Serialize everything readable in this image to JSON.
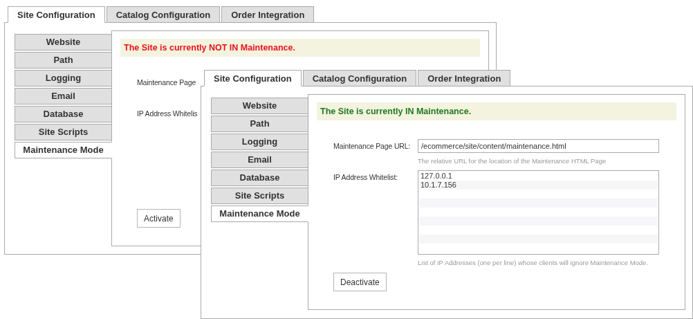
{
  "windows": [
    {
      "tabs": [
        {
          "label": "Site Configuration",
          "selected": true
        },
        {
          "label": "Catalog Configuration",
          "selected": false
        },
        {
          "label": "Order Integration",
          "selected": false
        }
      ],
      "nav": [
        {
          "label": "Website",
          "selected": false
        },
        {
          "label": "Path",
          "selected": false
        },
        {
          "label": "Logging",
          "selected": false
        },
        {
          "label": "Email",
          "selected": false
        },
        {
          "label": "Database",
          "selected": false
        },
        {
          "label": "Site Scripts",
          "selected": false
        },
        {
          "label": "Maintenance Mode",
          "selected": true
        }
      ],
      "status": {
        "text": "The Site is currently NOT IN Maintenance.",
        "in_maintenance": false
      },
      "fields": [
        {
          "label": "Maintenance Page"
        },
        {
          "label": "IP Address Whitelis"
        }
      ],
      "button": "Activate"
    },
    {
      "tabs": [
        {
          "label": "Site Configuration",
          "selected": true
        },
        {
          "label": "Catalog Configuration",
          "selected": false
        },
        {
          "label": "Order Integration",
          "selected": false
        }
      ],
      "nav": [
        {
          "label": "Website",
          "selected": false
        },
        {
          "label": "Path",
          "selected": false
        },
        {
          "label": "Logging",
          "selected": false
        },
        {
          "label": "Email",
          "selected": false
        },
        {
          "label": "Database",
          "selected": false
        },
        {
          "label": "Site Scripts",
          "selected": false
        },
        {
          "label": "Maintenance Mode",
          "selected": true
        }
      ],
      "status": {
        "text": "The Site is currently IN Maintenance.",
        "in_maintenance": true
      },
      "fields": [
        {
          "kind": "input",
          "label": "Maintenance Page URL:",
          "value": "/ecommerce/site/content/maintenance.html",
          "help": "The relative URL for the location of the Maintenance HTML Page"
        },
        {
          "kind": "list",
          "label": "IP Address Whitelist:",
          "lines": [
            "127.0.0.1",
            "10.1.7.156"
          ],
          "help": "List of IP Addresses (one per line) whose clients will ignore Maintenance Mode."
        }
      ],
      "button": "Deactivate"
    }
  ]
}
